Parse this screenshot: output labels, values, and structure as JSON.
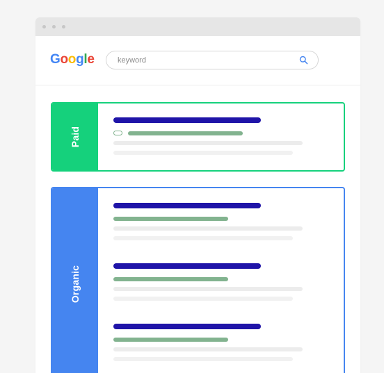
{
  "logo": {
    "letters": [
      {
        "char": "G",
        "color": "#4285f4"
      },
      {
        "char": "o",
        "color": "#ea4335"
      },
      {
        "char": "o",
        "color": "#fbbc05"
      },
      {
        "char": "g",
        "color": "#4285f4"
      },
      {
        "char": "l",
        "color": "#34a853"
      },
      {
        "char": "e",
        "color": "#ea4335"
      }
    ]
  },
  "search": {
    "placeholder": "keyword",
    "icon": "search-icon",
    "icon_color": "#4585f0"
  },
  "paid": {
    "label": "Paid",
    "color": "#15d17c"
  },
  "organic": {
    "label": "Organic",
    "color": "#4585f0",
    "result_count": 3
  },
  "colors": {
    "title_bar": "#1f14a8",
    "url_bar": "#82b38f",
    "snippet_bar": "#ececec",
    "background": "#f5f5f5"
  }
}
